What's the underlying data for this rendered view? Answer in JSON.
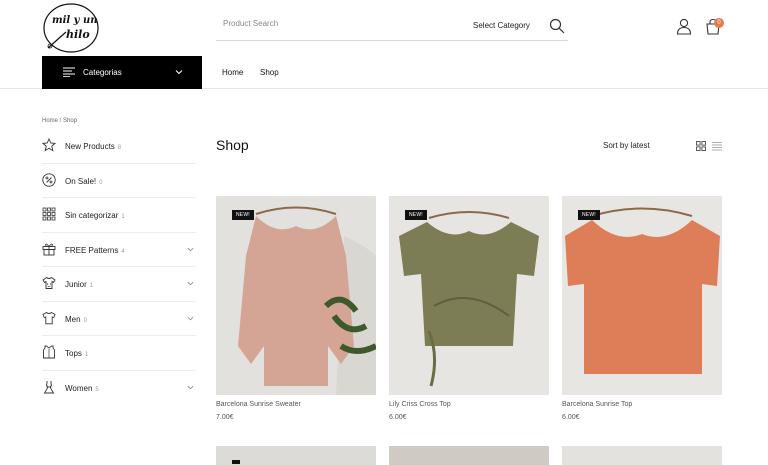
{
  "logo": {
    "text_line1": "mil y un",
    "text_line2": "hilo"
  },
  "header": {
    "search_placeholder": "Product Search",
    "select_category": "Select Category",
    "cart_count": "0"
  },
  "navbar": {
    "categories_label": "Categorias",
    "links": [
      "Home",
      "Shop"
    ]
  },
  "breadcrumb": {
    "home": "Home",
    "sep": " / ",
    "current": "Shop"
  },
  "sidebar": {
    "items": [
      {
        "label": "New Products",
        "count": "8",
        "icon": "star-icon",
        "expandable": false
      },
      {
        "label": "On Sale!",
        "count": "0",
        "icon": "percent-icon",
        "expandable": false
      },
      {
        "label": "Sin categorizar",
        "count": "1",
        "icon": "grid-squares-icon",
        "expandable": false
      },
      {
        "label": "FREE Patterns",
        "count": "4",
        "icon": "gift-icon",
        "expandable": true
      },
      {
        "label": "Junior",
        "count": "1",
        "icon": "baby-shirt-icon",
        "expandable": true
      },
      {
        "label": "Men",
        "count": "0",
        "icon": "tshirt-icon",
        "expandable": true
      },
      {
        "label": "Tops",
        "count": "1",
        "icon": "top-icon",
        "expandable": false
      },
      {
        "label": "Women",
        "count": "5",
        "icon": "dress-icon",
        "expandable": true
      }
    ]
  },
  "main": {
    "title": "Shop",
    "sort_label": "Sort by latest",
    "products": [
      {
        "name": "Barcelona Sunrise Sweater",
        "price": "7.00€",
        "badge": "NEW!",
        "color": "#d4a594"
      },
      {
        "name": "Lily Criss Cross Top",
        "price": "6.00€",
        "badge": "NEW!",
        "color": "#7c7d55"
      },
      {
        "name": "Barcelona Sunrise Top",
        "price": "6.00€",
        "badge": "NEW!",
        "color": "#dd7e58"
      }
    ]
  },
  "colors": {
    "accent": "#e8784d",
    "dark": "#000000"
  }
}
